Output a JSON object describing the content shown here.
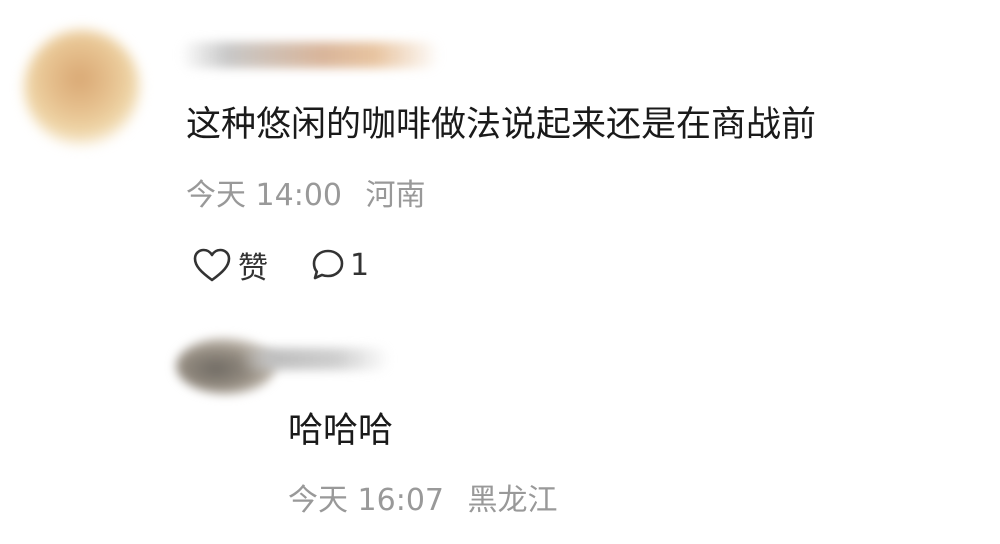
{
  "comment": {
    "text": "这种悠闲的咖啡做法说起来还是在商战前",
    "time": "今天 14:00",
    "location": "河南",
    "like_label": "赞",
    "reply_count": "1",
    "icons": {
      "like": "heart-icon",
      "reply": "speech-bubble-icon"
    }
  },
  "reply": {
    "text": "哈哈哈",
    "time": "今天 16:07",
    "location": "黑龙江"
  },
  "colors": {
    "primary_text": "#1a1a1a",
    "secondary_text": "#999999",
    "icon": "#333333",
    "background": "#ffffff"
  }
}
